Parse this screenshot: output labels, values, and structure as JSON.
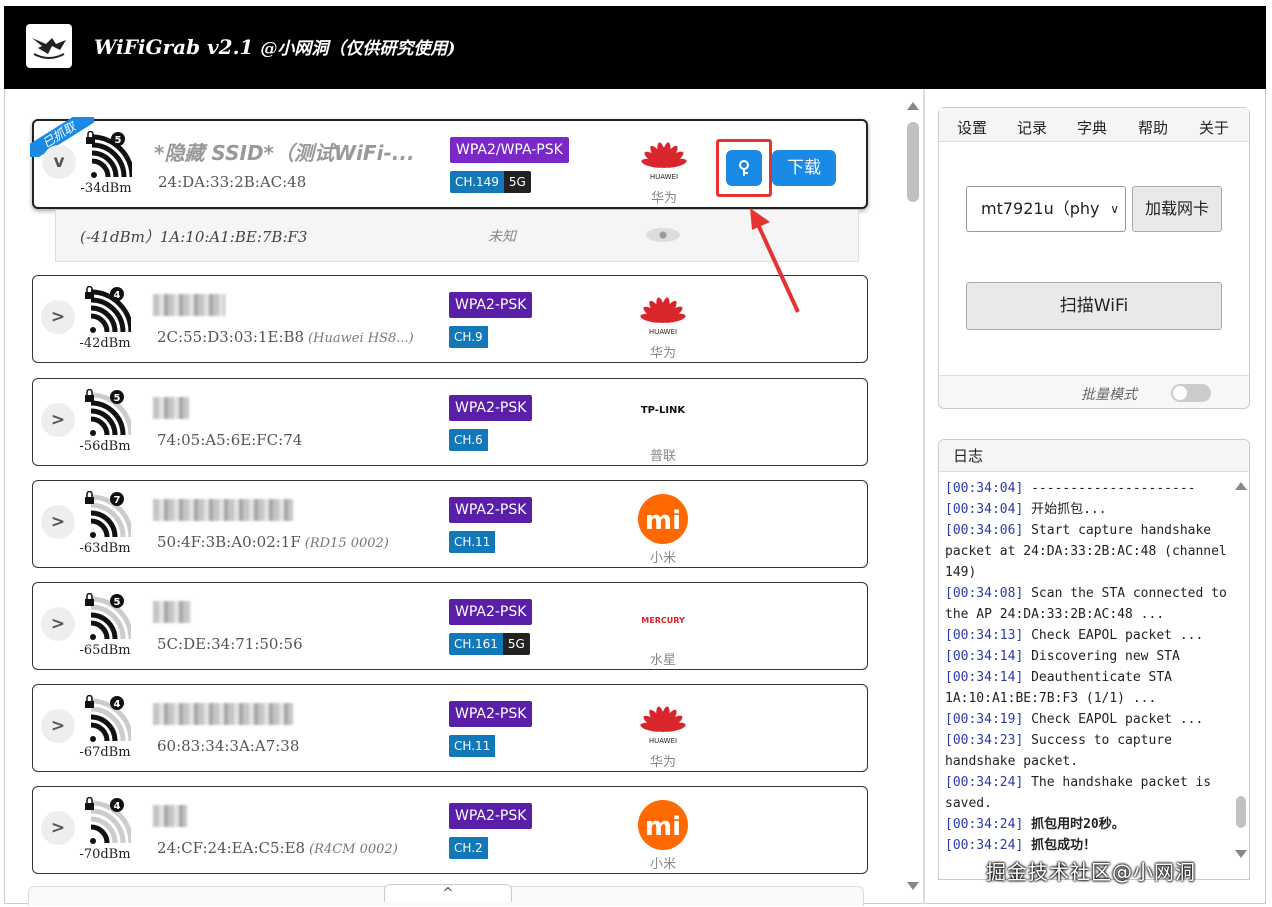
{
  "app": {
    "title": "WiFiGrab v2.1",
    "subtitle": "@小网洞（仅供研究使用)"
  },
  "networks": [
    {
      "ssid": "*隐藏 SSID*（测试WiFi-...",
      "mac": "24:DA:33:2B:AC:48",
      "mac_note": "",
      "dbm": "-34dBm",
      "encryption": "WPA2/WPA-PSK",
      "channel": "CH.149",
      "band": "5G",
      "vendor": "华为",
      "vendor_logo": "huawei-logo",
      "wifi_level": 4,
      "lock_num": "5",
      "expand": "v",
      "badge": "已抓取",
      "key_button": "key-icon",
      "download_label": "下载"
    },
    {
      "ssid": "",
      "mac": "2C:55:D3:03:1E:B8",
      "mac_note": "(Huawei HS8...)",
      "dbm": "-42dBm",
      "encryption": "WPA2-PSK",
      "channel": "CH.9",
      "band": "",
      "vendor": "华为",
      "vendor_logo": "huawei-logo",
      "wifi_level": 4,
      "lock_num": "4",
      "expand": ">"
    },
    {
      "ssid": "",
      "mac": "74:05:A5:6E:FC:74",
      "mac_note": "",
      "dbm": "-56dBm",
      "encryption": "WPA2-PSK",
      "channel": "CH.6",
      "band": "",
      "vendor": "普联",
      "vendor_logo": "tplink-logo",
      "vendor_logo_text": "TP-LINK",
      "wifi_level": 3,
      "lock_num": "5",
      "expand": ">"
    },
    {
      "ssid": "",
      "mac": "50:4F:3B:A0:02:1F",
      "mac_note": "(RD15 0002)",
      "dbm": "-63dBm",
      "encryption": "WPA2-PSK",
      "channel": "CH.11",
      "band": "",
      "vendor": "小米",
      "vendor_logo": "xiaomi-logo",
      "vendor_logo_text": "mi",
      "wifi_level": 2,
      "lock_num": "7",
      "expand": ">"
    },
    {
      "ssid": "",
      "mac": "5C:DE:34:71:50:56",
      "mac_note": "",
      "dbm": "-65dBm",
      "encryption": "WPA2-PSK",
      "channel": "CH.161",
      "band": "5G",
      "vendor": "水星",
      "vendor_logo": "mercury-logo",
      "vendor_logo_text": "MERCURY",
      "wifi_level": 2,
      "lock_num": "5",
      "expand": ">"
    },
    {
      "ssid": "",
      "mac": "60:83:34:3A:A7:38",
      "mac_note": "",
      "dbm": "-67dBm",
      "encryption": "WPA2-PSK",
      "channel": "CH.11",
      "band": "",
      "vendor": "华为",
      "vendor_logo": "huawei-logo",
      "wifi_level": 2,
      "lock_num": "4",
      "expand": ">"
    },
    {
      "ssid": "",
      "mac": "24:CF:24:EA:C5:E8",
      "mac_note": "(R4CM 0002)",
      "dbm": "-70dBm",
      "encryption": "WPA2-PSK",
      "channel": "CH.2",
      "band": "",
      "vendor": "小米",
      "vendor_logo": "xiaomi-logo",
      "vendor_logo_text": "mi",
      "wifi_level": 1,
      "lock_num": "4",
      "expand": ">"
    }
  ],
  "station": {
    "text": "(-41dBm）1A:10:A1:BE:7B:F3",
    "vendor": "未知"
  },
  "collapse_caret": "^",
  "settings": {
    "tabs": [
      "设置",
      "记录",
      "字典",
      "帮助",
      "关于"
    ],
    "adapter_value": "mt7921u（phy",
    "load_label": "加载网卡",
    "scan_label": "扫描WiFi",
    "batch_label": "批量模式",
    "batch_on": false
  },
  "log": {
    "title": "日志",
    "lines": [
      {
        "ts": "[00:34:04]",
        "msg": " ---------------------",
        "bold": false
      },
      {
        "ts": "[00:34:04]",
        "msg": " 开始抓包...",
        "bold": false
      },
      {
        "ts": "[00:34:06]",
        "msg": " Start capture handshake packet at 24:DA:33:2B:AC:48 (channel 149)",
        "bold": false
      },
      {
        "ts": "[00:34:08]",
        "msg": " Scan the STA connected to the AP 24:DA:33:2B:AC:48 ...",
        "bold": false
      },
      {
        "ts": "[00:34:13]",
        "msg": " Check EAPOL packet ...",
        "bold": false
      },
      {
        "ts": "[00:34:14]",
        "msg": " Discovering new STA",
        "bold": false
      },
      {
        "ts": "[00:34:14]",
        "msg": " Deauthenticate STA 1A:10:A1:BE:7B:F3 (1/1) ...",
        "bold": false
      },
      {
        "ts": "[00:34:19]",
        "msg": " Check EAPOL packet ...",
        "bold": false
      },
      {
        "ts": "[00:34:23]",
        "msg": " Success to capture handshake packet.",
        "bold": false
      },
      {
        "ts": "[00:34:24]",
        "msg": " The handshake packet is saved.",
        "bold": false
      },
      {
        "ts": "[00:34:24]",
        "msg": " 抓包用时20秒。",
        "bold": true
      },
      {
        "ts": "[00:34:24]",
        "msg": " 抓包成功！",
        "bold": true
      }
    ]
  },
  "watermark": "掘金技术社区@小网洞",
  "colors": {
    "accent": "#1a8ae5",
    "encryption": "#5a1fa8",
    "channel": "#1278b8",
    "highlight": "#e53333"
  }
}
